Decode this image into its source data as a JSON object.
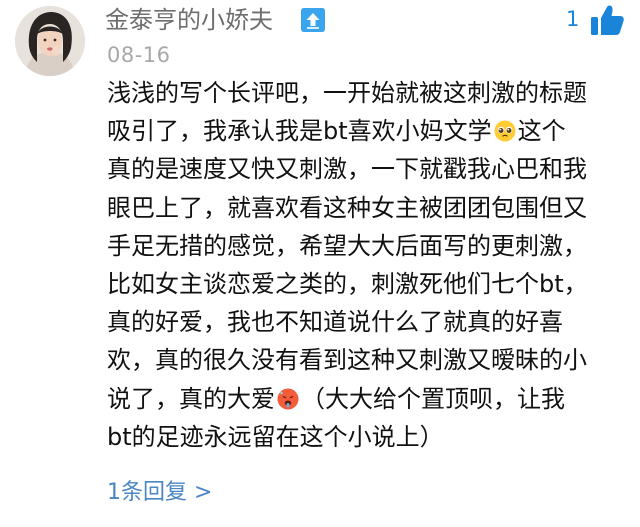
{
  "comment": {
    "author": {
      "username": "金泰亨的小娇夫",
      "avatar_icon": "user-avatar-icon",
      "badge_icon": "upvote-badge-icon",
      "badge_color": "#3aa4ee"
    },
    "date": "08-16",
    "likes": {
      "count": "1",
      "icon": "thumbs-up-icon",
      "color": "#1a84d9"
    },
    "body_lines": [
      {
        "segments": [
          {
            "text": "浅浅的写个长评吧，一开始就被这刺激的标题"
          }
        ]
      },
      {
        "segments": [
          {
            "text": "吸引了，我承认我是bt喜欢小妈文学"
          },
          {
            "emoji": "pleading-face-emoji"
          },
          {
            "text": "这个"
          }
        ]
      },
      {
        "segments": [
          {
            "text": "真的是速度又快又刺激，一下就戳我心巴和我"
          }
        ]
      },
      {
        "segments": [
          {
            "text": "眼巴上了，就喜欢看这种女主被团团包围但又"
          }
        ]
      },
      {
        "segments": [
          {
            "text": "手足无措的感觉，希望大大后面写的更刺激，"
          }
        ]
      },
      {
        "segments": [
          {
            "text": "比如女主谈恋爱之类的，刺激死他们七个bt，"
          }
        ]
      },
      {
        "segments": [
          {
            "text": "真的好爱，我也不知道说什么了就真的好喜"
          }
        ]
      },
      {
        "segments": [
          {
            "text": "欢，真的很久没有看到这种又刺激又暧昧的小"
          }
        ]
      },
      {
        "segments": [
          {
            "text": "说了，真的大爱"
          },
          {
            "emoji": "hot-face-emoji"
          },
          {
            "text": "（大大给个置顶呗，让我"
          }
        ]
      },
      {
        "segments": [
          {
            "text": "bt的足迹永远留在这个小说上）"
          }
        ]
      }
    ],
    "reply_link": "1条回复 >",
    "reply_link_color": "#4a86c4"
  }
}
